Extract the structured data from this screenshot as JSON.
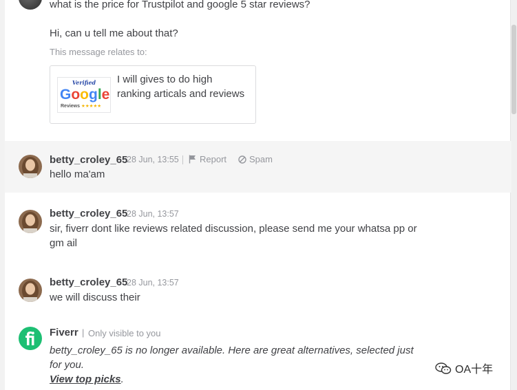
{
  "top_message": {
    "question": "what is the price for Trustpilot and google 5 star reviews?",
    "greeting": "Hi, can u tell me about that?",
    "relates_label": "This message relates to:",
    "gig": {
      "thumb_text": "Verified Google Reviews ★★★★★",
      "title": "I will gives to do high ranking articals and reviews"
    }
  },
  "messages": [
    {
      "username": "betty_croley_65",
      "timestamp": "28 Jun, 13:55",
      "report_label": "Report",
      "spam_label": "Spam",
      "text": "hello ma'am"
    },
    {
      "username": "betty_croley_65",
      "timestamp": "28 Jun, 13:57",
      "text": "sir, fiverr dont like reviews related discussion, please send me your whatsa pp or gm ail"
    },
    {
      "username": "betty_croley_65",
      "timestamp": "28 Jun, 13:57",
      "text": "we will discuss their"
    }
  ],
  "system_message": {
    "sender": "Fiverr",
    "separator": "|",
    "visibility": "Only visible to you",
    "body": "betty_croley_65 is no longer available. Here are great alternatives, selected just for you.",
    "link_text": "View top picks",
    "link_suffix": "."
  },
  "watermark": "OA十年",
  "colors": {
    "fiverr_green": "#1dbf73",
    "text": "#404145",
    "muted": "#95979d",
    "highlight_bg": "#f5f5f5"
  }
}
